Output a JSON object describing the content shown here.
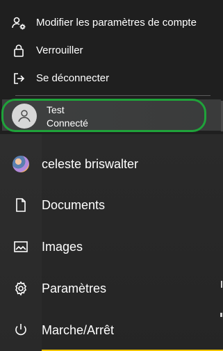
{
  "account_menu": {
    "items": [
      {
        "label": "Modifier les paramètres de compte",
        "icon": "account-settings-icon"
      },
      {
        "label": "Verrouiller",
        "icon": "lock-icon"
      },
      {
        "label": "Se déconnecter",
        "icon": "sign-out-icon"
      }
    ],
    "current_user": {
      "name": "Test",
      "status": "Connecté",
      "icon": "user-avatar-icon"
    }
  },
  "start_menu": {
    "items": [
      {
        "label": "celeste briswalter",
        "icon": "profile-avatar-icon"
      },
      {
        "label": "Documents",
        "icon": "document-icon"
      },
      {
        "label": "Images",
        "icon": "image-icon"
      },
      {
        "label": "Paramètres",
        "icon": "gear-icon"
      },
      {
        "label": "Marche/Arrêt",
        "icon": "power-icon"
      }
    ]
  },
  "colors": {
    "highlight": "#1fa33a",
    "background": "#202020",
    "text": "#ffffff"
  }
}
